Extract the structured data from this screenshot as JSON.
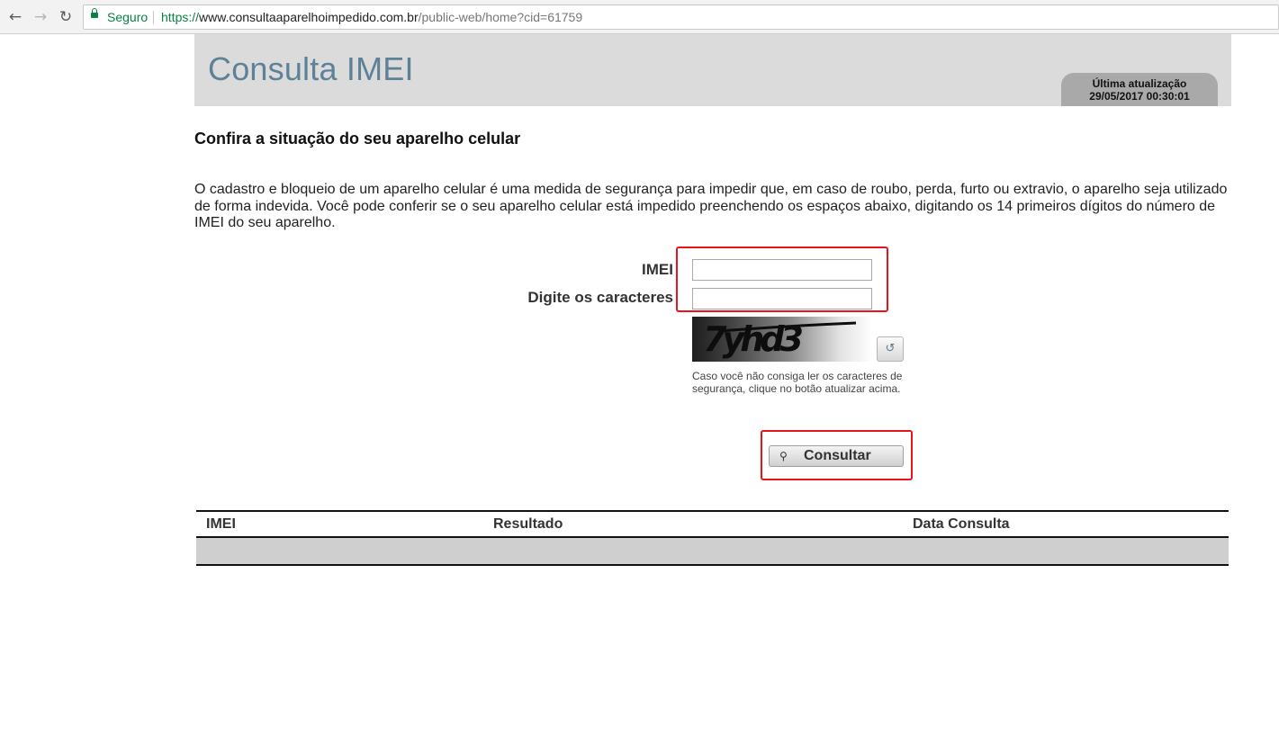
{
  "browser": {
    "secure_label": "Seguro",
    "url_scheme": "https://",
    "url_host": "www.consultaaparelhoimpedido.com.br",
    "url_path": "/public-web/home?cid=61759",
    "icons": {
      "back": "arrow-left-icon",
      "forward": "arrow-right-icon",
      "reload": "reload-icon",
      "lock": "lock-icon"
    }
  },
  "header": {
    "title": "Consulta IMEI",
    "update_label": "Última atualização",
    "update_value": "29/05/2017 00:30:01"
  },
  "main": {
    "subtitle": "Confira a situação do seu aparelho celular",
    "intro": "O cadastro e bloqueio de um aparelho celular é uma medida de segurança para impedir que, em caso de roubo, perda, furto ou extravio, o aparelho seja utilizado de forma indevida. Você pode conferir se o seu aparelho celular está impedido preenchendo os espaços abaixo, digitando os 14 primeiros dígitos do número de IMEI do seu aparelho."
  },
  "form": {
    "imei_label": "IMEI",
    "imei_value": "",
    "captcha_label": "Digite os caracteres",
    "captcha_value": "",
    "captcha_text": "7yhd3",
    "captcha_help": "Caso você não consiga ler os caracteres de segurança, clique no botão atualizar acima.",
    "submit_label": "Consultar",
    "icons": {
      "refresh": "refresh-icon",
      "submit": "magnifier-icon"
    }
  },
  "results": {
    "columns": [
      "IMEI",
      "Resultado",
      "Data Consulta"
    ],
    "rows": []
  },
  "colors": {
    "header_bg": "#dbdbdb",
    "title": "#5e8197",
    "badge_bg": "#a9a9a9",
    "highlight": "#e8141c",
    "secure": "#0b8043",
    "row_bg": "#cfcfcf"
  }
}
